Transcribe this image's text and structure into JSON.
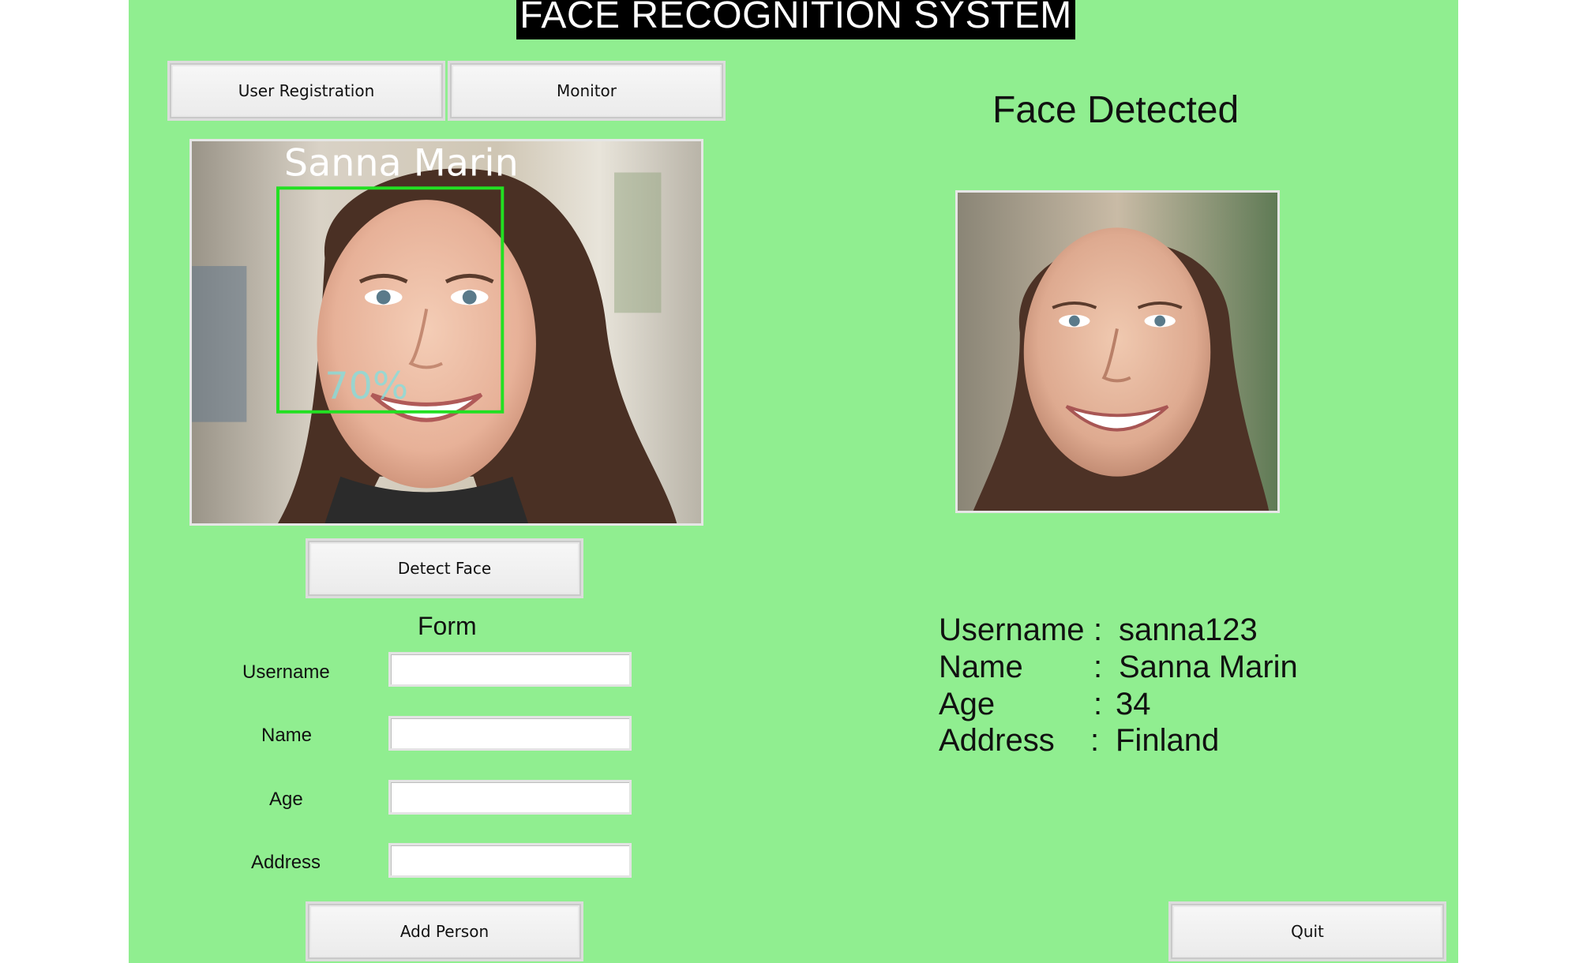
{
  "app": {
    "title": "FACE RECOGNITION SYSTEM",
    "background_color": "#90ee90"
  },
  "nav": {
    "user_registration_label": "User Registration",
    "monitor_label": "Monitor"
  },
  "camera": {
    "overlay_name": "Sanna Marin",
    "overlay_confidence": "70%",
    "box_color": "#22e022"
  },
  "detect_button_label": "Detect Face",
  "form": {
    "heading": "Form",
    "fields": [
      {
        "label": "Username",
        "value": "",
        "placeholder": ""
      },
      {
        "label": "Name",
        "value": "",
        "placeholder": ""
      },
      {
        "label": "Age",
        "value": "",
        "placeholder": ""
      },
      {
        "label": "Address",
        "value": "",
        "placeholder": ""
      }
    ],
    "add_button_label": "Add Person"
  },
  "detected": {
    "heading": "Face Detected",
    "details": [
      {
        "key": "Username",
        "sep": ":",
        "value": "sanna123"
      },
      {
        "key": "Name",
        "sep": ":",
        "value": "Sanna Marin"
      },
      {
        "key": "Age",
        "sep": ":",
        "value": "34"
      },
      {
        "key": "Address",
        "sep": ":",
        "value": "Finland"
      }
    ]
  },
  "quit_button_label": "Quit"
}
